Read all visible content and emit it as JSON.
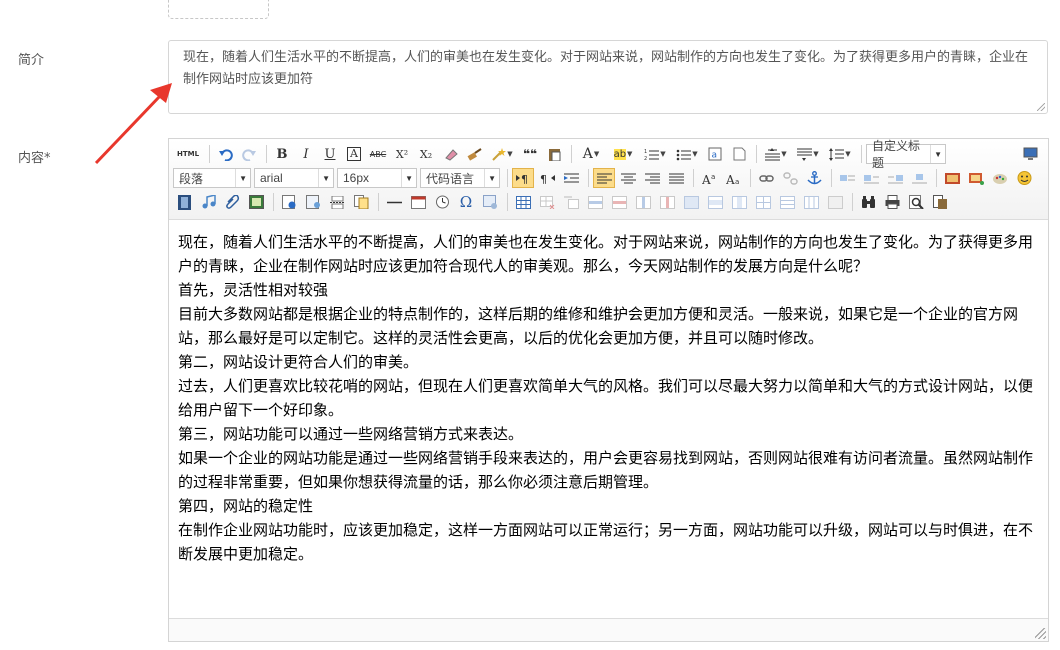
{
  "form": {
    "summary_label": "简介",
    "summary_text": "现在，随着人们生活水平的不断提高，人们的审美也在发生变化。对于网站来说，网站制作的方向也发生了变化。为了获得更多用户的青睐，企业在制作网站时应该更加符",
    "content_label": "内容*"
  },
  "toolbar": {
    "html_label": "HTML",
    "bold": "B",
    "italic": "I",
    "underline": "U",
    "font_border": "A",
    "strike": "ABC",
    "superscript": "X²",
    "subscript": "X₂",
    "blockquote": "❝❝",
    "forecolor": "A",
    "backcolor": "ab",
    "custom_title": "自定义标题",
    "paragraph": "段落",
    "font_family": "arial",
    "font_size": "16px",
    "code_language": "代码语言",
    "omega": "Ω"
  },
  "colors": {
    "accent_arrow": "#e8372c",
    "active_button_bg": "#fcdc8a",
    "border": "#d4d4d4"
  },
  "icons": [
    "undo-icon",
    "redo-icon",
    "eraser-icon",
    "brush-icon",
    "magic-icon",
    "paste-icon",
    "list-ordered-icon",
    "list-unordered-icon",
    "anchor-icon",
    "image-icon",
    "emoticon-icon",
    "video-icon",
    "music-icon",
    "attachment-icon",
    "map-icon",
    "table-icon",
    "search-icon",
    "print-icon",
    "preview-icon",
    "drafts-icon"
  ],
  "content": {
    "paragraphs": [
      "现在，随着人们生活水平的不断提高，人们的审美也在发生变化。对于网站来说，网站制作的方向也发生了变化。为了获得更多用户的青睐，企业在制作网站时应该更加符合现代人的审美观。那么，今天网站制作的发展方向是什么呢？",
      "首先，灵活性相对较强",
      "目前大多数网站都是根据企业的特点制作的，这样后期的维修和维护会更加方便和灵活。一般来说，如果它是一个企业的官方网站，那么最好是可以定制它。这样的灵活性会更高，以后的优化会更加方便，并且可以随时修改。",
      "第二，网站设计更符合人们的审美。",
      "过去，人们更喜欢比较花哨的网站，但现在人们更喜欢简单大气的风格。我们可以尽最大努力以简单和大气的方式设计网站，以便给用户留下一个好印象。",
      "第三，网站功能可以通过一些网络营销方式来表达。",
      "如果一个企业的网站功能是通过一些网络营销手段来表达的，用户会更容易找到网站，否则网站很难有访问者流量。虽然网站制作的过程非常重要，但如果你想获得流量的话，那么你必须注意后期管理。",
      "第四，网站的稳定性",
      "在制作企业网站功能时，应该更加稳定，这样一方面网站可以正常运行；另一方面，网站功能可以升级，网站可以与时俱进，在不断发展中更加稳定。"
    ]
  }
}
